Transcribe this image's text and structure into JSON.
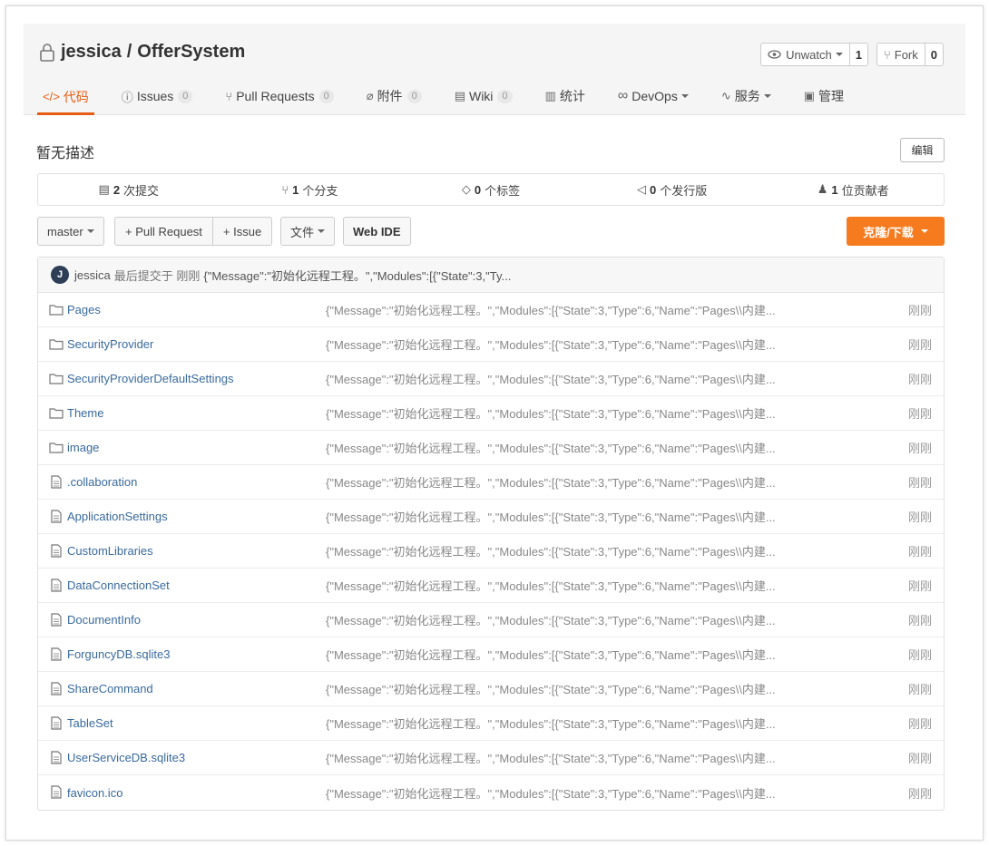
{
  "repo": {
    "owner": "jessica",
    "separator": "/",
    "name": "OfferSystem"
  },
  "watch": {
    "label": "Unwatch",
    "count": "1"
  },
  "fork": {
    "label": "Fork",
    "count": "0"
  },
  "tabs": [
    {
      "label": "代码",
      "icon": "code-icon",
      "glyph": "</>",
      "badge": ""
    },
    {
      "label": "Issues",
      "icon": "issue-icon",
      "glyph": "ⓘ",
      "badge": "0"
    },
    {
      "label": "Pull Requests",
      "icon": "pull-request-icon",
      "glyph": "⑂",
      "badge": "0"
    },
    {
      "label": "附件",
      "icon": "paperclip-icon",
      "glyph": "⌀",
      "badge": "0"
    },
    {
      "label": "Wiki",
      "icon": "book-icon",
      "glyph": "▤",
      "badge": "0"
    },
    {
      "label": "统计",
      "icon": "bar-chart-icon",
      "glyph": "▥",
      "badge": ""
    },
    {
      "label": "DevOps",
      "icon": "infinity-icon",
      "glyph": "∞",
      "badge": ""
    },
    {
      "label": "服务",
      "icon": "pulse-icon",
      "glyph": "∿",
      "badge": ""
    },
    {
      "label": "管理",
      "icon": "settings-doc-icon",
      "glyph": "▣",
      "badge": ""
    }
  ],
  "description": "暂无描述",
  "edit_label": "编辑",
  "stats": [
    {
      "count": "2",
      "label": "次提交",
      "icon": "commit-icon",
      "glyph": "▤"
    },
    {
      "count": "1",
      "label": "个分支",
      "icon": "branch-icon",
      "glyph": "⑂"
    },
    {
      "count": "0",
      "label": "个标签",
      "icon": "tag-icon",
      "glyph": "◇"
    },
    {
      "count": "0",
      "label": "个发行版",
      "icon": "release-icon",
      "glyph": "◁"
    },
    {
      "count": "1",
      "label": "位贡献者",
      "icon": "contributors-icon",
      "glyph": "♟"
    }
  ],
  "toolbar": {
    "branch": "master",
    "pull_request": "+ Pull Request",
    "issue": "+ Issue",
    "files": "文件",
    "web_ide": "Web IDE",
    "clone": "克隆/下载"
  },
  "last_commit": {
    "avatar_letter": "J",
    "author": "jessica",
    "text": "最后提交于 刚刚",
    "message": "{\"Message\":\"初始化远程工程。\",\"Modules\":[{\"State\":3,\"Ty..."
  },
  "files": [
    {
      "name": "Pages",
      "type": "folder",
      "message": "{\"Message\":\"初始化远程工程。\",\"Modules\":[{\"State\":3,\"Type\":6,\"Name\":\"Pages\\\\内建...",
      "time": "刚刚"
    },
    {
      "name": "SecurityProvider",
      "type": "folder",
      "message": "{\"Message\":\"初始化远程工程。\",\"Modules\":[{\"State\":3,\"Type\":6,\"Name\":\"Pages\\\\内建...",
      "time": "刚刚"
    },
    {
      "name": "SecurityProviderDefaultSettings",
      "type": "folder",
      "message": "{\"Message\":\"初始化远程工程。\",\"Modules\":[{\"State\":3,\"Type\":6,\"Name\":\"Pages\\\\内建...",
      "time": "刚刚"
    },
    {
      "name": "Theme",
      "type": "folder",
      "message": "{\"Message\":\"初始化远程工程。\",\"Modules\":[{\"State\":3,\"Type\":6,\"Name\":\"Pages\\\\内建...",
      "time": "刚刚"
    },
    {
      "name": "image",
      "type": "folder",
      "message": "{\"Message\":\"初始化远程工程。\",\"Modules\":[{\"State\":3,\"Type\":6,\"Name\":\"Pages\\\\内建...",
      "time": "刚刚"
    },
    {
      "name": ".collaboration",
      "type": "file",
      "message": "{\"Message\":\"初始化远程工程。\",\"Modules\":[{\"State\":3,\"Type\":6,\"Name\":\"Pages\\\\内建...",
      "time": "刚刚"
    },
    {
      "name": "ApplicationSettings",
      "type": "file",
      "message": "{\"Message\":\"初始化远程工程。\",\"Modules\":[{\"State\":3,\"Type\":6,\"Name\":\"Pages\\\\内建...",
      "time": "刚刚"
    },
    {
      "name": "CustomLibraries",
      "type": "file",
      "message": "{\"Message\":\"初始化远程工程。\",\"Modules\":[{\"State\":3,\"Type\":6,\"Name\":\"Pages\\\\内建...",
      "time": "刚刚"
    },
    {
      "name": "DataConnectionSet",
      "type": "file",
      "message": "{\"Message\":\"初始化远程工程。\",\"Modules\":[{\"State\":3,\"Type\":6,\"Name\":\"Pages\\\\内建...",
      "time": "刚刚"
    },
    {
      "name": "DocumentInfo",
      "type": "file",
      "message": "{\"Message\":\"初始化远程工程。\",\"Modules\":[{\"State\":3,\"Type\":6,\"Name\":\"Pages\\\\内建...",
      "time": "刚刚"
    },
    {
      "name": "ForguncyDB.sqlite3",
      "type": "file",
      "message": "{\"Message\":\"初始化远程工程。\",\"Modules\":[{\"State\":3,\"Type\":6,\"Name\":\"Pages\\\\内建...",
      "time": "刚刚"
    },
    {
      "name": "ShareCommand",
      "type": "file",
      "message": "{\"Message\":\"初始化远程工程。\",\"Modules\":[{\"State\":3,\"Type\":6,\"Name\":\"Pages\\\\内建...",
      "time": "刚刚"
    },
    {
      "name": "TableSet",
      "type": "file",
      "message": "{\"Message\":\"初始化远程工程。\",\"Modules\":[{\"State\":3,\"Type\":6,\"Name\":\"Pages\\\\内建...",
      "time": "刚刚"
    },
    {
      "name": "UserServiceDB.sqlite3",
      "type": "file",
      "message": "{\"Message\":\"初始化远程工程。\",\"Modules\":[{\"State\":3,\"Type\":6,\"Name\":\"Pages\\\\内建...",
      "time": "刚刚"
    },
    {
      "name": "favicon.ico",
      "type": "file",
      "message": "{\"Message\":\"初始化远程工程。\",\"Modules\":[{\"State\":3,\"Type\":6,\"Name\":\"Pages\\\\内建...",
      "time": "刚刚"
    }
  ],
  "colors": {
    "accent": "#e65c12",
    "clone": "#f67b1f",
    "link": "#3a6a9e"
  }
}
